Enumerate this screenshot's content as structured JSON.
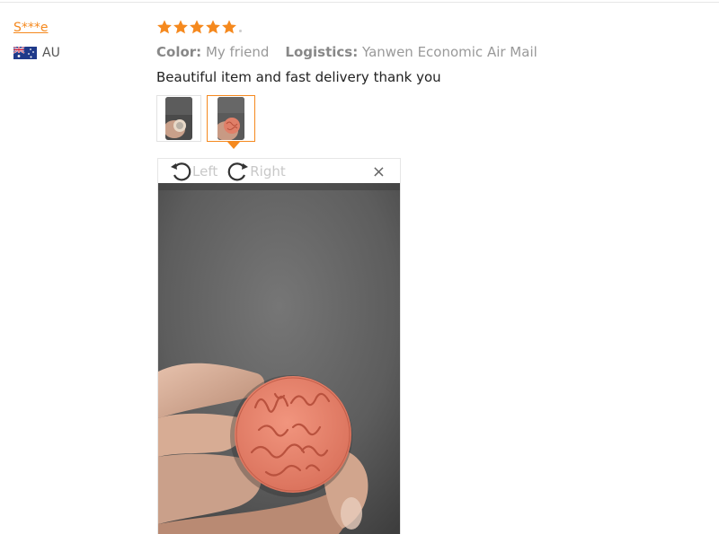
{
  "reviewer": {
    "name": "S***e",
    "country_code": "AU"
  },
  "review": {
    "rating": 5,
    "color_label": "Color:",
    "color_value": "My friend",
    "logistics_label": "Logistics:",
    "logistics_value": "Yanwen Economic Air Mail",
    "text": "Beautiful item and fast delivery thank you",
    "active_thumbnail_index": 2,
    "thumbnail_count": 2
  },
  "viewer": {
    "rotate_left_label": "Left",
    "rotate_right_label": "Right",
    "close_glyph": "×"
  },
  "colors": {
    "accent": "#f5891e",
    "star": "#f5891e",
    "stamp": "#e8826a",
    "background_photo": "#5a5a5a"
  },
  "icons": {
    "rotate_left": "rotate-left-icon",
    "rotate_right": "rotate-right-icon",
    "close": "close-icon",
    "flag": "australia-flag-icon",
    "star": "star-icon"
  }
}
